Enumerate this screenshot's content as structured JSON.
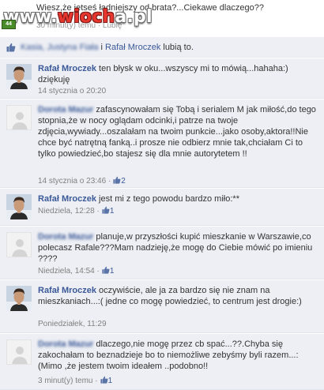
{
  "top": {
    "line": "Wiesz,że jetseś ładniejszy od brata?...Ciekawe dlaczego??",
    "meta": "30 minut(y) temu · Lubię"
  },
  "watermark": {
    "prefix": "www.",
    "accent": "wioch",
    "suffix": "a.pl",
    "badge": "44"
  },
  "likes_bar": {
    "blurred_names": "Kasia, Justyna Fiała",
    "connector": "i",
    "name": "Rafał Mroczek",
    "suffix": "lubią to."
  },
  "comments": [
    {
      "author": "Rafał Mroczek",
      "author_blurred": false,
      "avatar": "photo",
      "text": "ten błysk w oku...wszyscy mi to mówią...hahaha:) dziękuję",
      "time": "14 stycznia o 20:20",
      "likes": ""
    },
    {
      "author": "Dorota Mazur",
      "author_blurred": true,
      "avatar": "default",
      "text": "zafascynowałam się Tobą i serialem M jak miłość,do tego stopnia,że w nocy oglądam odcinki,i patrze na twoje zdjęcia,wywiady...oszalałam na twoim punkcie...jako osoby,aktora!!Nie chce być natrętną fanką..i prosze nie odbierz mnie tak,chciałam Ci to tylko powiedzieć,bo stajesz się dla mnie autorytetem !!",
      "time": "14 stycznia o 23:46 ·",
      "likes": "2"
    },
    {
      "author": "Rafał Mroczek",
      "author_blurred": false,
      "avatar": "photo",
      "text": "jest mi z tego powodu bardzo miło:**",
      "time": "Niedziela, 12:28 ·",
      "likes": "1"
    },
    {
      "author": "Dorota Mazur",
      "author_blurred": true,
      "avatar": "default",
      "text": "planuje,w przyszłości kupić mieszkanie w Warszawie,co polecasz Rafale???Mam nadzieję,że mogę do Ciebie mówić po imieniu ????",
      "time": "Niedziela, 14:54 ·",
      "likes": "1"
    },
    {
      "author": "Rafał Mroczek",
      "author_blurred": false,
      "avatar": "photo",
      "text": "oczywiście, ale ja za bardzo się nie znam na mieszkaniach...:( jedne co mogę powiedzieć, to centrum jest drogie:)",
      "time": "Poniedziałek, 11:29",
      "likes": ""
    },
    {
      "author": "Dorota Mazur",
      "author_blurred": true,
      "avatar": "default",
      "text": "dlaczego,nie mogę przez cb spać...??.Chyba się zakochałam to beznadzieje bo to niemożliwe zebyśmy byli razem...:(Mimo ,że jestem twoim ideałem ..podobno!!",
      "time": "3 minut(y) temu ·",
      "likes": "1"
    }
  ],
  "colors": {
    "link": "#3b5998",
    "comment_bg": "#edeff4",
    "meta": "#808080",
    "watermark_accent": "#e8352e"
  },
  "icons": {
    "like": "thumbs-up-icon",
    "avatar_default": "default-avatar-icon",
    "avatar_photo": "profile-photo"
  }
}
